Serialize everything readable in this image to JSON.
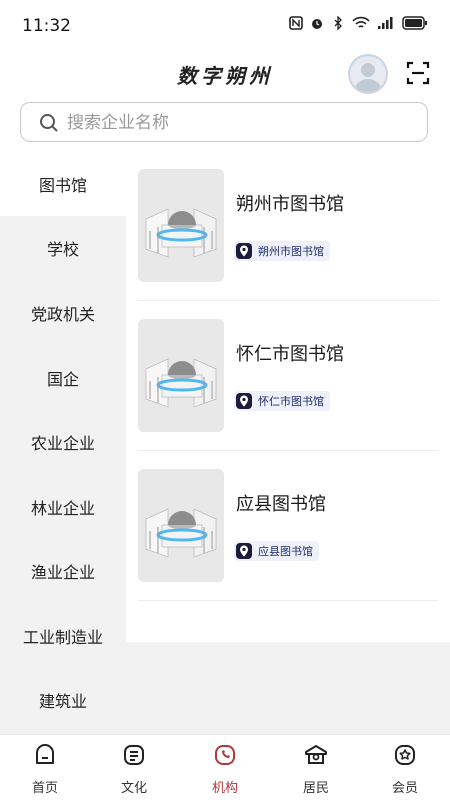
{
  "status_bar": {
    "time": "11:32"
  },
  "header": {
    "title": "数字朔州"
  },
  "search": {
    "placeholder": "搜索企业名称"
  },
  "categories": [
    {
      "label": "图书馆",
      "active": true
    },
    {
      "label": "学校"
    },
    {
      "label": "党政机关"
    },
    {
      "label": "国企"
    },
    {
      "label": "农业企业"
    },
    {
      "label": "林业企业"
    },
    {
      "label": "渔业企业"
    },
    {
      "label": "工业制造业"
    },
    {
      "label": "建筑业"
    }
  ],
  "organizations": [
    {
      "name": "朔州市图书馆",
      "tag": "朔州市图书馆"
    },
    {
      "name": "怀仁市图书馆",
      "tag": "怀仁市图书馆"
    },
    {
      "name": "应县图书馆",
      "tag": "应县图书馆"
    }
  ],
  "bottom_nav": [
    {
      "label": "首页",
      "icon": "home-icon"
    },
    {
      "label": "文化",
      "icon": "culture-icon"
    },
    {
      "label": "机构",
      "icon": "institution-icon",
      "active": true
    },
    {
      "label": "居民",
      "icon": "resident-icon"
    },
    {
      "label": "会员",
      "icon": "member-icon"
    }
  ],
  "colors": {
    "active_nav": "#b03a3a",
    "tag_bg": "#eef1f9",
    "tag_text": "#1e2c6b",
    "sidebar_bg": "#f2f2f2"
  }
}
